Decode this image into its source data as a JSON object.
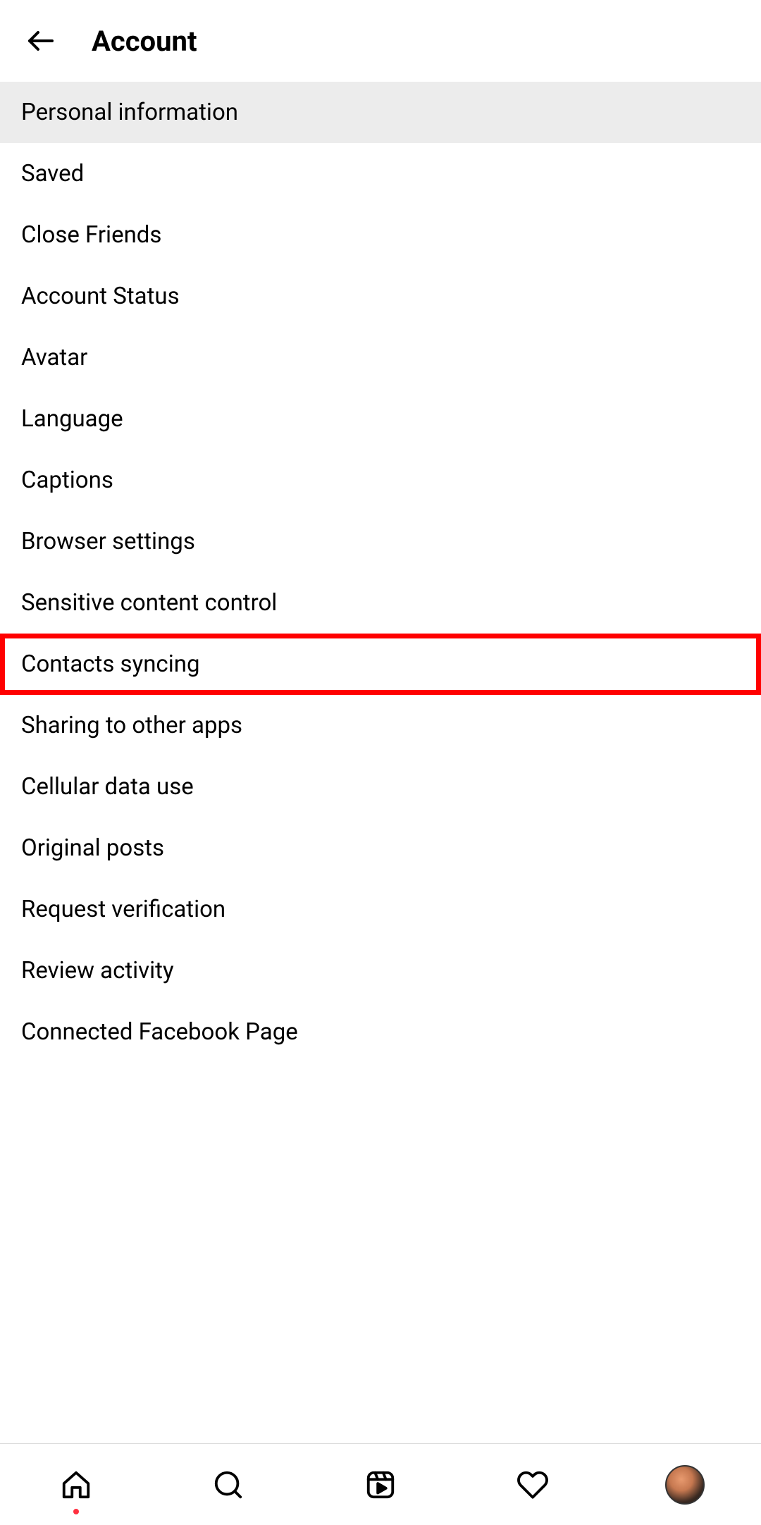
{
  "header": {
    "title": "Account"
  },
  "menu": {
    "items": [
      {
        "label": "Personal information",
        "highlighted": true,
        "redbox": false
      },
      {
        "label": "Saved",
        "highlighted": false,
        "redbox": false
      },
      {
        "label": "Close Friends",
        "highlighted": false,
        "redbox": false
      },
      {
        "label": "Account Status",
        "highlighted": false,
        "redbox": false
      },
      {
        "label": "Avatar",
        "highlighted": false,
        "redbox": false
      },
      {
        "label": "Language",
        "highlighted": false,
        "redbox": false
      },
      {
        "label": "Captions",
        "highlighted": false,
        "redbox": false
      },
      {
        "label": "Browser settings",
        "highlighted": false,
        "redbox": false
      },
      {
        "label": "Sensitive content control",
        "highlighted": false,
        "redbox": false
      },
      {
        "label": "Contacts syncing",
        "highlighted": false,
        "redbox": true
      },
      {
        "label": "Sharing to other apps",
        "highlighted": false,
        "redbox": false
      },
      {
        "label": "Cellular data use",
        "highlighted": false,
        "redbox": false
      },
      {
        "label": "Original posts",
        "highlighted": false,
        "redbox": false
      },
      {
        "label": "Request verification",
        "highlighted": false,
        "redbox": false
      },
      {
        "label": "Review activity",
        "highlighted": false,
        "redbox": false
      },
      {
        "label": "Connected Facebook Page",
        "highlighted": false,
        "redbox": false
      }
    ]
  },
  "bottom_nav": {
    "home_has_dot": true
  }
}
